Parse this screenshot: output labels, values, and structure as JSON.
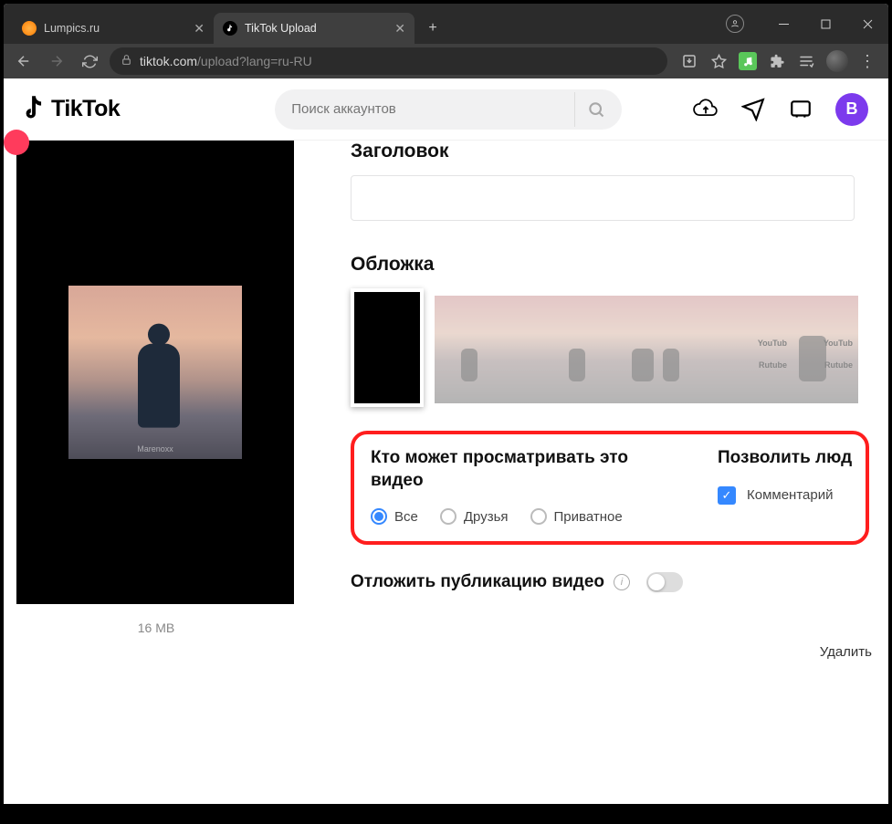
{
  "browser": {
    "tabs": [
      {
        "title": "Lumpics.ru",
        "active": false,
        "favicon": "orange"
      },
      {
        "title": "TikTok Upload",
        "active": true,
        "favicon": "tiktok"
      }
    ],
    "url_host": "tiktok.com",
    "url_path": "/upload?lang=ru-RU"
  },
  "header": {
    "brand": "TikTok",
    "search_placeholder": "Поиск аккаунтов",
    "avatar_initial": "В"
  },
  "upload": {
    "file_size": "16 MB",
    "title_label": "Заголовок",
    "cover_label": "Обложка",
    "cover_watermarks": {
      "youtube": "YouTub",
      "rutube": "Rutube"
    },
    "visibility": {
      "title": "Кто может просматривать это видео",
      "options": {
        "all": "Все",
        "friends": "Друзья",
        "private": "Приватное"
      },
      "selected": "all"
    },
    "allow": {
      "title": "Позволить люд",
      "comment_label": "Комментарий",
      "comment_checked": true
    },
    "schedule_label": "Отложить публикацию видео",
    "delete_label": "Удалить",
    "preview_watermark": "Marenoxx"
  }
}
